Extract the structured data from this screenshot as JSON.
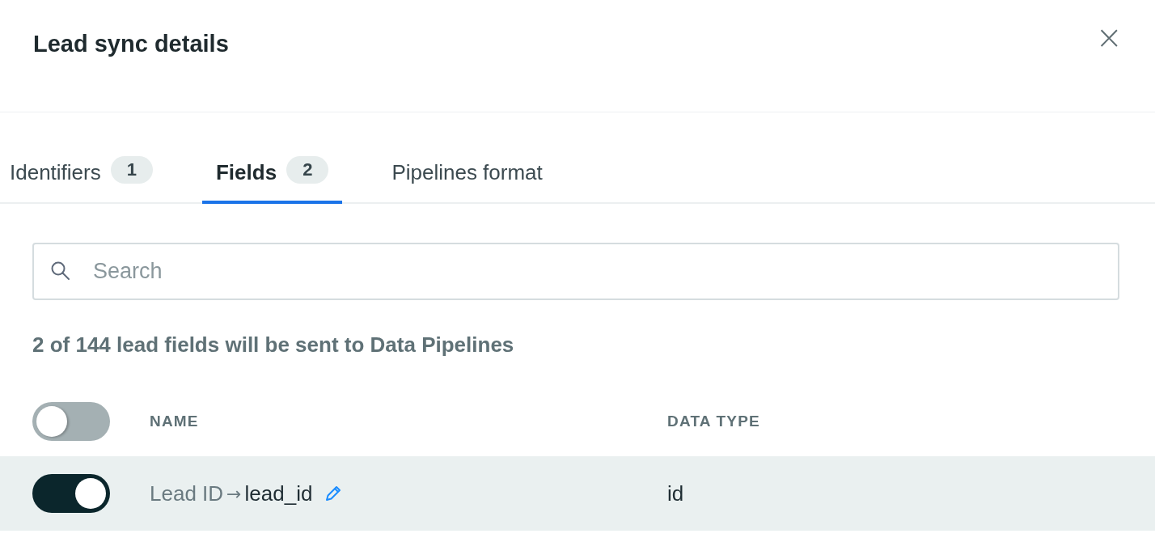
{
  "dialog": {
    "title": "Lead sync details",
    "close": "×"
  },
  "tabs": [
    {
      "label": "Identifiers",
      "count": "1",
      "selected": false
    },
    {
      "label": "Fields",
      "count": "2",
      "selected": true
    },
    {
      "label": "Pipelines format",
      "selected": false
    }
  ],
  "search": {
    "placeholder": "Search"
  },
  "summary": "2 of 144 lead fields will be sent to Data Pipelines",
  "table": {
    "select_all": {
      "on": false
    },
    "columns": [
      "NAME",
      "DATA TYPE"
    ],
    "rows": [
      {
        "on": true,
        "source": "Lead ID",
        "arrow": "→",
        "target": "lead_id",
        "data_type": "id"
      }
    ]
  }
}
